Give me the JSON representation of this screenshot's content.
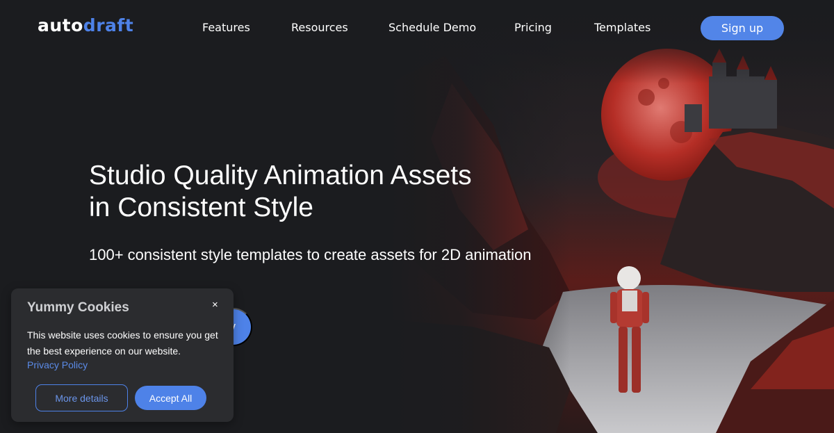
{
  "header": {
    "logo": {
      "part1": "auto",
      "part2": "draft"
    },
    "nav": [
      {
        "label": "Features"
      },
      {
        "label": "Resources"
      },
      {
        "label": "Schedule Demo"
      },
      {
        "label": "Pricing"
      },
      {
        "label": "Templates"
      }
    ],
    "signup_label": "Sign up"
  },
  "hero": {
    "title_line1": "Studio Quality Animation Assets",
    "title_line2": "in Consistent Style",
    "subtitle": "100+ consistent style templates to create assets for 2D animation",
    "cta_label_visible": "y",
    "image_alt": "astronaut walking toward castle under red moon"
  },
  "cookie_banner": {
    "title": "Yummy Cookies",
    "close_symbol": "×",
    "message": "This website uses cookies to ensure you get the best experience on our website.",
    "privacy_link": "Privacy Policy",
    "more_details_label": "More details",
    "accept_label": "Accept All"
  },
  "colors": {
    "accent": "#4e82e8",
    "background": "#1b1c1f",
    "banner": "#2b2c2f"
  }
}
